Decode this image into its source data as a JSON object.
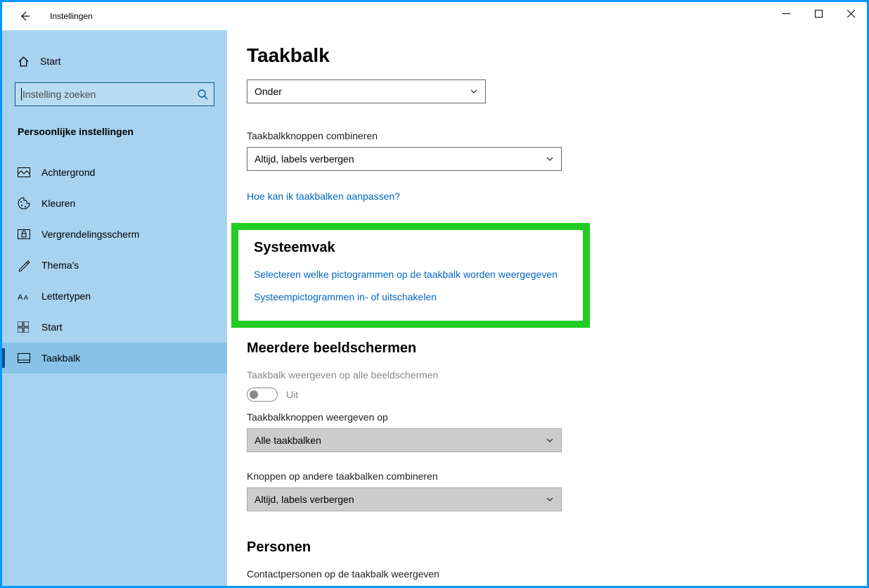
{
  "window": {
    "title": "Instellingen"
  },
  "sidebar": {
    "home": "Start",
    "search_placeholder": "Instelling zoeken",
    "category": "Persoonlijke instellingen",
    "items": [
      {
        "icon": "background-icon",
        "label": "Achtergrond"
      },
      {
        "icon": "colors-icon",
        "label": "Kleuren"
      },
      {
        "icon": "lockscreen-icon",
        "label": "Vergrendelingsscherm"
      },
      {
        "icon": "themes-icon",
        "label": "Thema's"
      },
      {
        "icon": "fonts-icon",
        "label": "Lettertypen"
      },
      {
        "icon": "start-icon",
        "label": "Start"
      },
      {
        "icon": "taskbar-icon",
        "label": "Taakbalk"
      }
    ],
    "selected_index": 6
  },
  "content": {
    "page_title": "Taakbalk",
    "position_value": "Onder",
    "combine_label": "Taakbalkknoppen combineren",
    "combine_value": "Altijd, labels verbergen",
    "help_link": "Hoe kan ik taakbalken aanpassen?",
    "systray": {
      "title": "Systeemvak",
      "link1": "Selecteren welke pictogrammen op de taakbalk worden weergegeven",
      "link2": "Systeempictogrammen in- of uitschakelen"
    },
    "multi": {
      "title": "Meerdere beeldschermen",
      "show_all_label": "Taakbalk weergeven op alle beeldschermen",
      "show_all_state": "Uit",
      "show_buttons_label": "Taakbalkknoppen weergeven op",
      "show_buttons_value": "Alle taakbalken",
      "combine_other_label": "Knoppen op andere taakbalken combineren",
      "combine_other_value": "Altijd, labels verbergen"
    },
    "people": {
      "title": "Personen",
      "contacts_label": "Contactpersonen op de taakbalk weergeven"
    }
  }
}
